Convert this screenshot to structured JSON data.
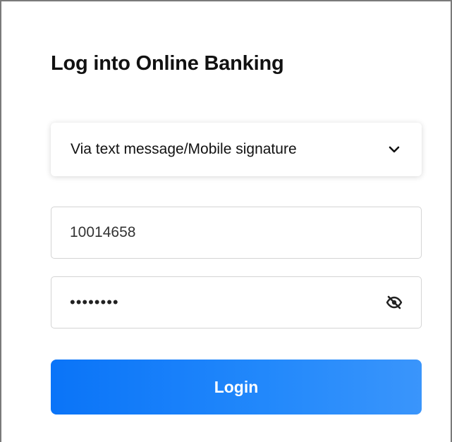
{
  "page": {
    "title": "Log into Online Banking"
  },
  "login_method": {
    "selected": "Via text message/Mobile signature",
    "icon": "chevron-down-icon"
  },
  "username": {
    "value": "10014658"
  },
  "password": {
    "value": "••••••••",
    "toggle_icon": "eye-off-icon"
  },
  "actions": {
    "login_label": "Login"
  },
  "colors": {
    "primary": "#0a74f8",
    "primary_light": "#3a95fb",
    "text": "#111111",
    "border": "#d4d4d4",
    "frame_border": "#7a7a7a"
  }
}
